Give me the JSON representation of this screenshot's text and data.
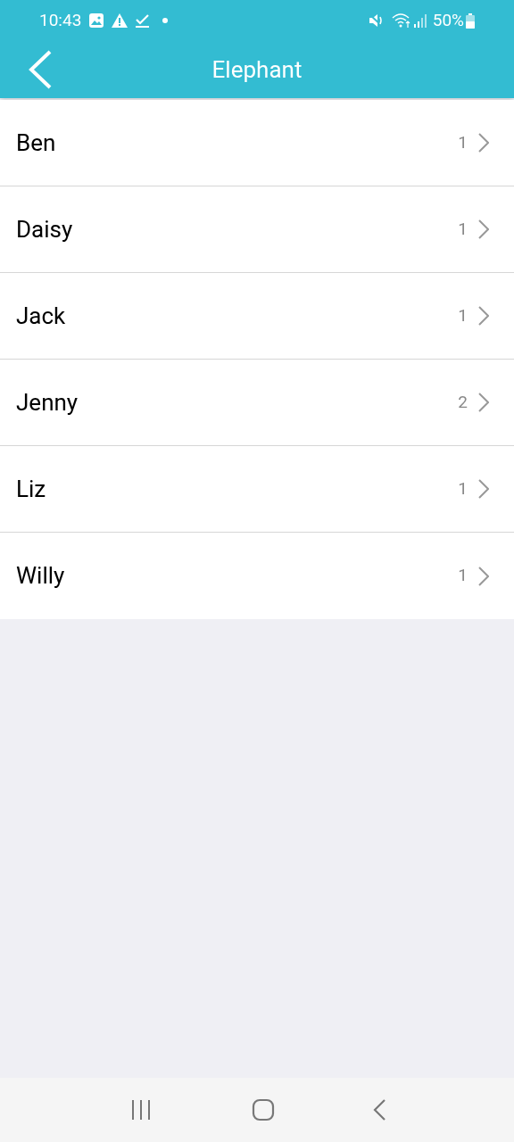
{
  "status_bar": {
    "time": "10:43",
    "battery": "50%"
  },
  "header": {
    "title": "Elephant"
  },
  "items": [
    {
      "name": "Ben",
      "count": "1"
    },
    {
      "name": "Daisy",
      "count": "1"
    },
    {
      "name": "Jack",
      "count": "1"
    },
    {
      "name": "Jenny",
      "count": "2"
    },
    {
      "name": "Liz",
      "count": "1"
    },
    {
      "name": "Willy",
      "count": "1"
    }
  ]
}
